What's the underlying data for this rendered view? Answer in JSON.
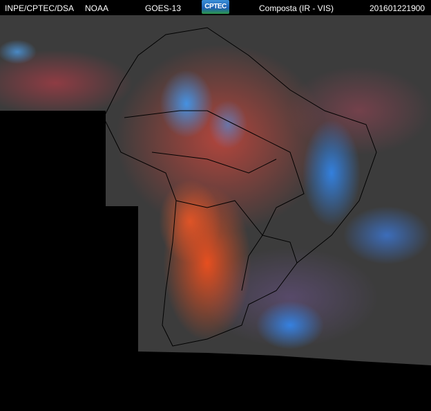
{
  "header": {
    "institution": "INPE/CPTEC/DSA",
    "agency": "NOAA",
    "satellite": "GOES-13",
    "logo_text": "CPTEC",
    "product": "Composta (IR - VIS)",
    "timestamp": "201601221900"
  }
}
